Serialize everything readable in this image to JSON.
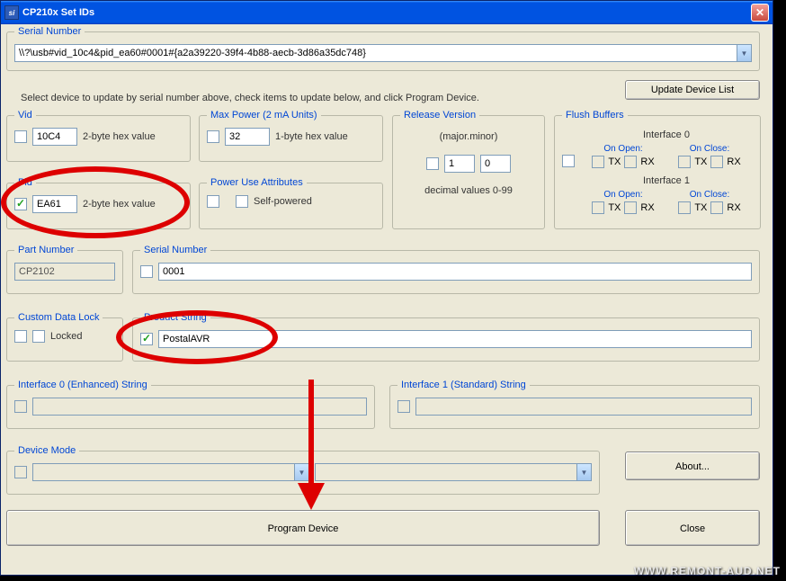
{
  "window": {
    "title": "CP210x Set IDs"
  },
  "serialTop": {
    "legend": "Serial Number",
    "value": "\\\\?\\usb#vid_10c4&pid_ea60#0001#{a2a39220-39f4-4b88-aecb-3d86a35dc748}"
  },
  "instruction": "Select device to update by serial number above, check items to update below, and click Program Device.",
  "updateBtn": "Update Device List",
  "vid": {
    "legend": "Vid",
    "value": "10C4",
    "hint": "2-byte hex value"
  },
  "pid": {
    "legend": "Pid",
    "value": "EA61",
    "hint": "2-byte hex value"
  },
  "maxPower": {
    "legend": "Max Power (2 mA Units)",
    "value": "32",
    "hint": "1-byte hex value"
  },
  "powerUse": {
    "legend": "Power Use Attributes",
    "label": "Self-powered"
  },
  "release": {
    "legend": "Release Version",
    "hint": "(major.minor)",
    "major": "1",
    "minor": "0",
    "note": "decimal values 0-99"
  },
  "flush": {
    "legend": "Flush Buffers",
    "if0": "Interface 0",
    "if1": "Interface 1",
    "open": "On Open:",
    "close": "On Close:",
    "tx": "TX",
    "rx": "RX"
  },
  "partNum": {
    "legend": "Part Number",
    "value": "CP2102"
  },
  "serialNum": {
    "legend": "Serial Number",
    "value": "0001"
  },
  "customLock": {
    "legend": "Custom Data Lock",
    "label": "Locked"
  },
  "productString": {
    "legend": "Product String",
    "value": "PostalAVR"
  },
  "if0str": {
    "legend": "Interface 0 (Enhanced) String",
    "value": ""
  },
  "if1str": {
    "legend": "Interface 1 (Standard) String",
    "value": ""
  },
  "deviceMode": {
    "legend": "Device Mode"
  },
  "aboutBtn": "About...",
  "programBtn": "Program Device",
  "closeBtn": "Close",
  "watermark": "WWW.REMONT-AUD.NET"
}
